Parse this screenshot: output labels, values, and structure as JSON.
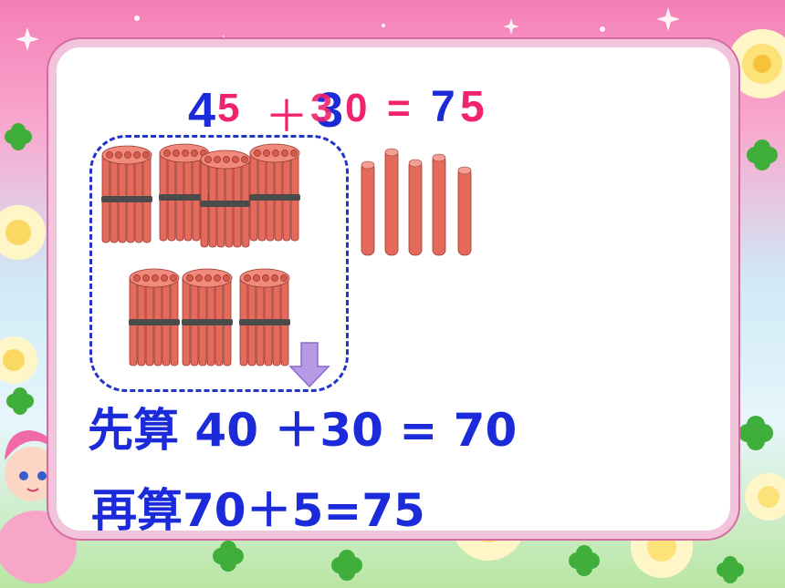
{
  "equation": {
    "tens_digit_a": "4",
    "ones_digit_a": "5",
    "plus": "＋",
    "tens_digit_b_over": "3",
    "tens_digit_b": "3",
    "ones_digit_b": "0",
    "equals_part": "= ",
    "result_tens": "7",
    "result_ones": "5"
  },
  "steps": {
    "first": "先算 40 ＋30 = 70",
    "second": "再算70＋5=75"
  },
  "counters": {
    "bundles": 7,
    "single_sticks": 5
  },
  "colors": {
    "blue": "#1c2bd9",
    "pink": "#f0246e",
    "stick": "#e46a5c",
    "arrow": "#b79ae3"
  }
}
